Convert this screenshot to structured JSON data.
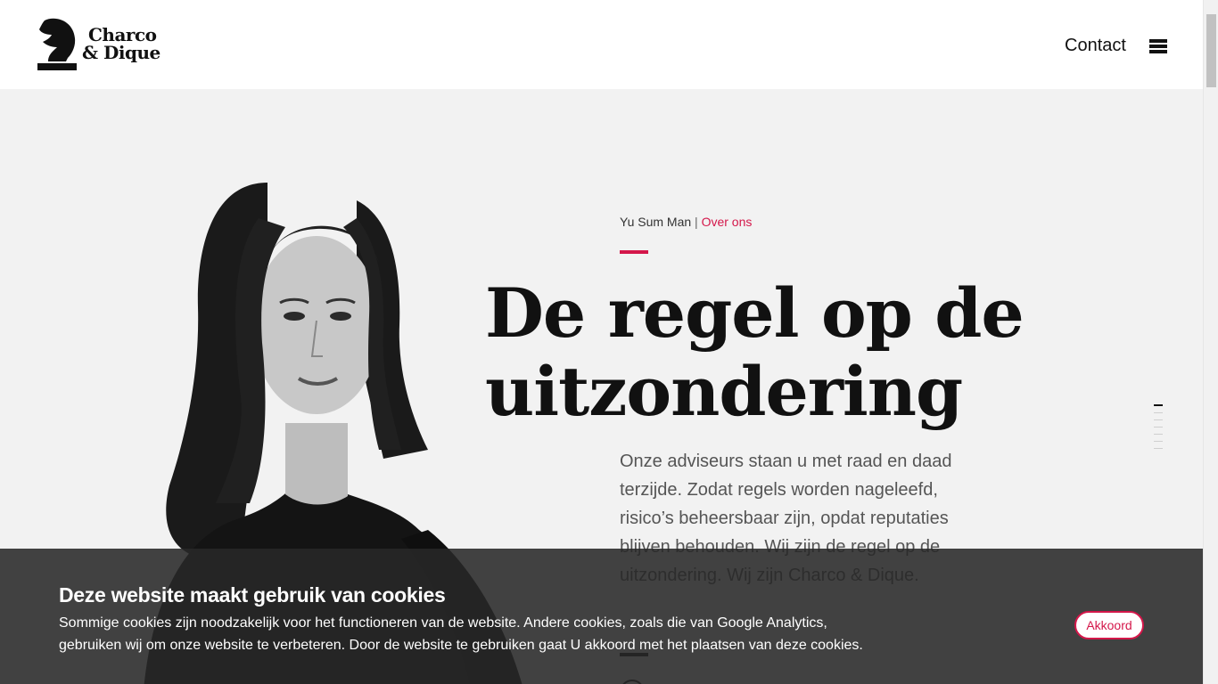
{
  "header": {
    "logo_line1": "Charco",
    "logo_line2": "& Dique",
    "contact_label": "Contact",
    "menu_icon": "hamburger-menu-icon"
  },
  "hero": {
    "breadcrumb_name": "Yu Sum Man",
    "breadcrumb_sep": "|",
    "breadcrumb_link": "Over ons",
    "headline_line1": "De regel op de",
    "headline_line2": "uitzondering",
    "intro": "Onze adviseurs staan u met raad en daad terzijde. Zodat regels worden nageleefd, risico’s beheersbaar zijn, opdat reputaties blijven behouden. Wij zijn de regel op de uitzondering. Wij zijn Charco & Dique.",
    "scroll_icon": "chevron-down-icon"
  },
  "cookie": {
    "title": "Deze website maakt gebruik van cookies",
    "text": "Sommige cookies zijn noodzakelijk voor het functioneren van de website. Andere cookies, zoals die van Google Analytics, gebruiken wij om onze website te verbeteren. Door de website te gebruiken gaat U akkoord met het plaatsen van deze cookies.",
    "accept_label": "Akkoord"
  },
  "colors": {
    "accent": "#d4174a",
    "text": "#111111",
    "background": "#f2f2f2",
    "banner": "#282828"
  }
}
